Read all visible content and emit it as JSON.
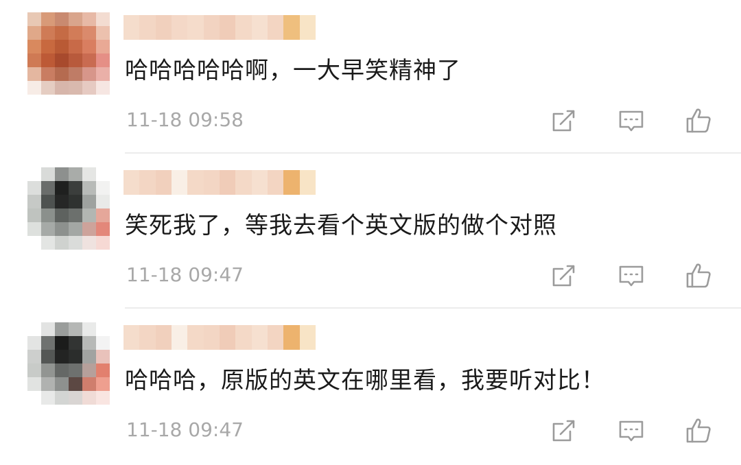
{
  "comments": [
    {
      "text": "哈哈哈哈哈啊，一大早笑精神了",
      "time": "11-18 09:58",
      "avatar_pixels": [
        "#e8c8b4",
        "#d89a78",
        "#c98a70",
        "#d9a58c",
        "#e7b9a6",
        "#f3dcd1",
        "#e0a889",
        "#cf7b56",
        "#c56b45",
        "#d27c58",
        "#da8a6c",
        "#ecc1ae",
        "#d9895e",
        "#c8693f",
        "#b95a35",
        "#c86a48",
        "#d97e60",
        "#e9a995",
        "#cf7a54",
        "#bd5a36",
        "#a84a2d",
        "#b85a3c",
        "#c96b51",
        "#e58f86",
        "#e4b7a0",
        "#c97d62",
        "#b56b50",
        "#bf7c66",
        "#d7968a",
        "#eab0a8",
        "#f7ece6",
        "#e5cdc2",
        "#d7b6ab",
        "#d9b9ae",
        "#e6cac2",
        "#f6e6e2"
      ],
      "username_pixels": [
        "#f5ddcc",
        "#f3d6c4",
        "#f1d0bd",
        "#f4d8c7",
        "#f5dccb",
        "#f2d3c1",
        "#f0ccb8",
        "#f4d9c7",
        "#f6e0d0",
        "#f3d5c2",
        "#efbf7e",
        "#f8e4c6"
      ]
    },
    {
      "text": "笑死我了，等我去看个英文版的做个对照",
      "time": "11-18 09:47",
      "avatar_pixels": [
        "#ffffff",
        "#d9dbd9",
        "#8d908e",
        "#a9aca9",
        "#e5e6e4",
        "#ffffff",
        "#dcdedc",
        "#6a6d6b",
        "#1f201f",
        "#3b3e3c",
        "#b8bbb8",
        "#f2f2f1",
        "#c6c9c6",
        "#4e5250",
        "#262726",
        "#2f3230",
        "#9ea29f",
        "#e9eae8",
        "#bfc3bf",
        "#8b908c",
        "#5e625f",
        "#6c706d",
        "#b2b6b2",
        "#e5a79a",
        "#dde0dd",
        "#a6aaa7",
        "#8d918e",
        "#a3a7a4",
        "#cda39b",
        "#e3877a",
        "#ffffff",
        "#e3e5e3",
        "#cfd2cf",
        "#dadcda",
        "#efe2df",
        "#f6d9d4"
      ],
      "username_pixels": [
        "#f5ddcc",
        "#f3d6c4",
        "#f1d0bd",
        "#f9efe6",
        "#f4d9c7",
        "#f3d6c4",
        "#f0ccb8",
        "#f4d9c7",
        "#f6e0d0",
        "#f3d5c2",
        "#edb36e",
        "#f8e4c6"
      ]
    },
    {
      "text": "哈哈哈，原版的英文在哪里看，我要听对比！",
      "time": "11-18 09:47",
      "avatar_pixels": [
        "#ffffff",
        "#e2e3e2",
        "#9a9d9b",
        "#b5b7b5",
        "#e9eae9",
        "#ffffff",
        "#e3e4e3",
        "#6f7270",
        "#1b1c1b",
        "#323433",
        "#b7b9b7",
        "#f3f3f3",
        "#cdcfcd",
        "#545755",
        "#232423",
        "#2b2d2c",
        "#a1a3a1",
        "#e9c2bb",
        "#c8cbc8",
        "#929592",
        "#656866",
        "#6e716f",
        "#b6a09b",
        "#e2806e",
        "#e1e3e1",
        "#b0b2b0",
        "#8e918f",
        "#5c4843",
        "#cf7e6d",
        "#ee9f8f",
        "#ffffff",
        "#e8e9e8",
        "#d3d5d3",
        "#d9d5d3",
        "#f0dbd6",
        "#f9e5e1"
      ],
      "username_pixels": [
        "#f5ddcc",
        "#f3d6c4",
        "#f1d0bd",
        "#f9efe6",
        "#f4d9c7",
        "#f3d6c4",
        "#f0ccb8",
        "#f4d9c7",
        "#f6e0d0",
        "#f3d5c2",
        "#edb36e",
        "#f8e4c6"
      ]
    }
  ],
  "icons": {
    "share": "share-icon",
    "reply": "reply-icon",
    "like": "like-icon",
    "color": "#9b9b9b"
  }
}
